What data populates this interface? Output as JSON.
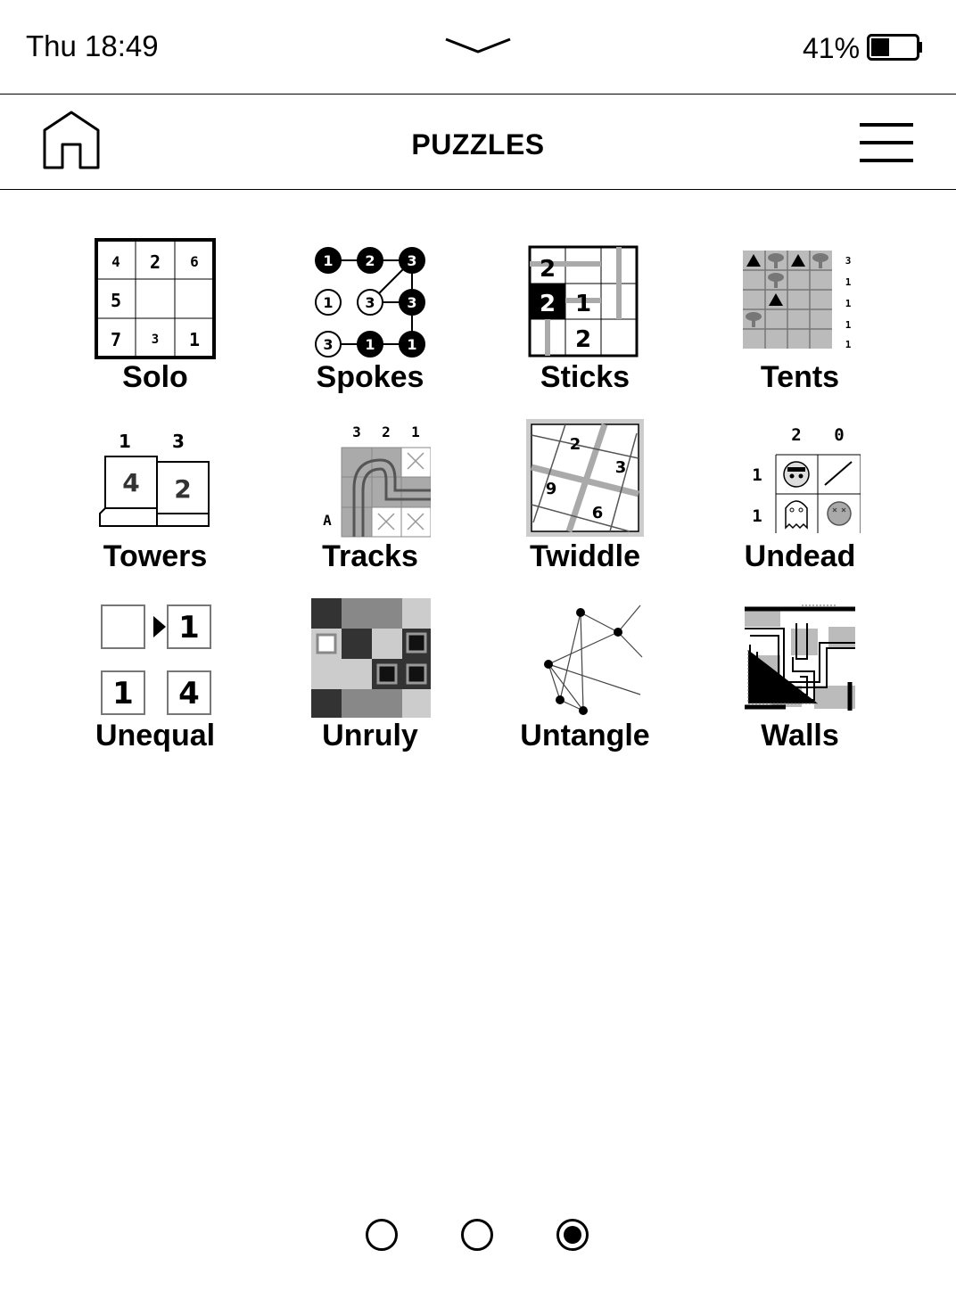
{
  "status": {
    "time": "Thu 18:49",
    "battery": "41%",
    "battery_level": 0.41
  },
  "header": {
    "title": "PUZZLES",
    "home_icon": "home-icon",
    "menu_icon": "hamburger-menu-icon"
  },
  "puzzles": [
    {
      "label": "Solo"
    },
    {
      "label": "Spokes"
    },
    {
      "label": "Sticks"
    },
    {
      "label": "Tents"
    },
    {
      "label": "Towers"
    },
    {
      "label": "Tracks"
    },
    {
      "label": "Twiddle"
    },
    {
      "label": "Undead"
    },
    {
      "label": "Unequal"
    },
    {
      "label": "Unruly"
    },
    {
      "label": "Untangle"
    },
    {
      "label": "Walls"
    }
  ],
  "thumbs": {
    "solo": [
      "4",
      "2",
      "6",
      "5",
      "7",
      "3",
      "1"
    ],
    "spokes": [
      "1",
      "2",
      "3",
      "1",
      "3",
      "3",
      "3",
      "1",
      "1"
    ],
    "sticks": [
      "2",
      "2",
      "1",
      "2"
    ],
    "tents": [
      "3",
      "1",
      "1",
      "1",
      "1"
    ],
    "towers": [
      "1",
      "3",
      "4",
      "2"
    ],
    "tracks": [
      "3",
      "2",
      "1",
      "A"
    ],
    "twiddle": [
      "2",
      "3",
      "9",
      "6"
    ],
    "undead": [
      "2",
      "0",
      "1",
      "1"
    ],
    "unequal": [
      "1",
      "1",
      "4"
    ]
  },
  "pager": {
    "pages": 3,
    "current": 3
  }
}
